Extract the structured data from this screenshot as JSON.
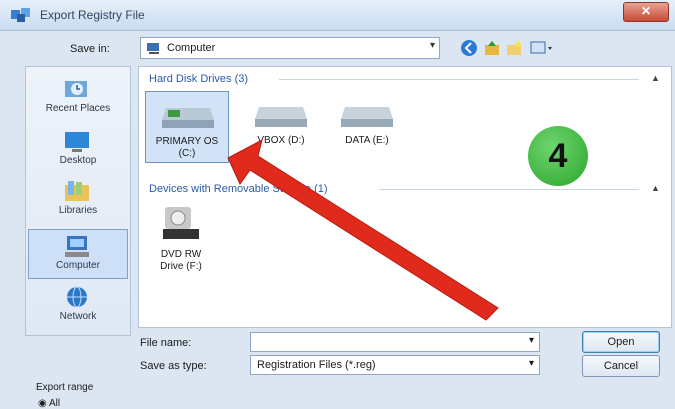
{
  "window": {
    "title": "Export Registry File"
  },
  "toolbar": {
    "save_in_label": "Save in:",
    "location": "Computer"
  },
  "places": [
    {
      "label": "Recent Places",
      "icon": "recent-places-icon"
    },
    {
      "label": "Desktop",
      "icon": "desktop-icon"
    },
    {
      "label": "Libraries",
      "icon": "libraries-icon"
    },
    {
      "label": "Computer",
      "icon": "computer-icon",
      "active": true
    },
    {
      "label": "Network",
      "icon": "network-icon"
    }
  ],
  "groups": {
    "hard_disks": "Hard Disk Drives (3)",
    "removable": "Devices with Removable Storage (1)"
  },
  "drives": [
    {
      "line1": "PRIMARY OS",
      "line2": "(C:)",
      "selected": true
    },
    {
      "line1": "VBOX (D:)",
      "line2": ""
    },
    {
      "line1": "DATA (E:)",
      "line2": ""
    }
  ],
  "dvd": {
    "line1": "DVD RW",
    "line2": "Drive (F:)"
  },
  "annotation": {
    "step": "4",
    "arrow_color": "#e02a1c",
    "badge_color": "#34b034"
  },
  "form": {
    "file_name_label": "File name:",
    "file_name_value": "",
    "save_type_label": "Save as type:",
    "save_type_value": "Registration Files (*.reg)",
    "open_label": "Open",
    "cancel_label": "Cancel"
  },
  "export": {
    "range_label": "Export range",
    "all_label": "All"
  }
}
